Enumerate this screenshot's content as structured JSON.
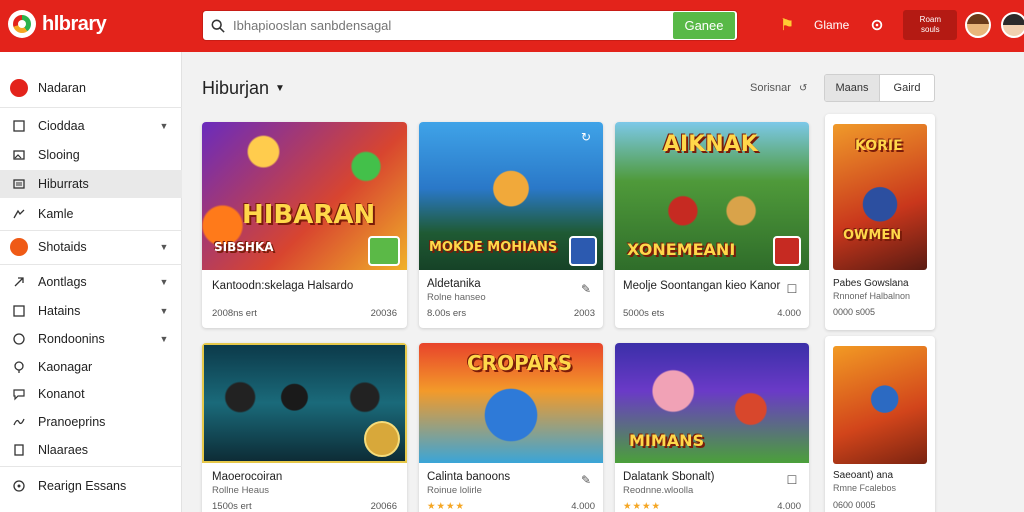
{
  "app": {
    "title": "hlbrary"
  },
  "search": {
    "placeholder": "Ibhapiooslan sanbdensagal",
    "button_label": "Ganee"
  },
  "topbar": {
    "game_label": "Glame",
    "account_line1": "Roam",
    "account_line2": "souls"
  },
  "sidebar": {
    "items": [
      {
        "label": "Nadaran",
        "icon": "home-icon",
        "has_caret": false
      },
      {
        "label": "Cioddaa",
        "icon": "square-icon",
        "has_caret": true
      },
      {
        "label": "Slooing",
        "icon": "image-icon",
        "has_caret": false
      },
      {
        "label": "Hiburrats",
        "icon": "list-icon",
        "has_caret": false,
        "active": true
      },
      {
        "label": "Kamle",
        "icon": "puzzle-icon",
        "has_caret": false
      },
      {
        "label": "Shotaids",
        "icon": "fire-icon",
        "has_caret": true
      },
      {
        "label": "Aontlags",
        "icon": "arrow-icon",
        "has_caret": true
      },
      {
        "label": "Hatains",
        "icon": "square-icon",
        "has_caret": true
      },
      {
        "label": "Rondoonins",
        "icon": "clock-icon",
        "has_caret": true
      },
      {
        "label": "Kaonagar",
        "icon": "pin-icon",
        "has_caret": false
      },
      {
        "label": "Konanot",
        "icon": "chat-icon",
        "has_caret": false
      },
      {
        "label": "Pranoeprins",
        "icon": "wave-icon",
        "has_caret": false
      },
      {
        "label": "Nlaaraes",
        "icon": "doc-icon",
        "has_caret": false
      },
      {
        "label": "Rearign Essans",
        "icon": "circle-icon",
        "has_caret": false
      }
    ]
  },
  "main": {
    "title": "Hiburjan",
    "sort_label": "Sorisnar",
    "segments": [
      "Maans",
      "Gaird"
    ]
  },
  "cards": [
    {
      "title": "Kantoodn:skelaga Halsardo",
      "sub": "",
      "meta_left": "2008ns ert",
      "meta_right": "20036",
      "overlay": "HIBARAN",
      "overlay2": "SIBSHKA"
    },
    {
      "title": "Aldetanika",
      "sub": "Rolne hanseo",
      "meta_left": "8.00s ers",
      "meta_right": "2003",
      "overlay": "MOKDE MOHIANS"
    },
    {
      "title": "Meolje Soontangan kieo Kanor",
      "sub": "",
      "meta_left": "5000s ets",
      "meta_right": "4.000",
      "overlay": "AIKNAK",
      "overlay2": "XONEMEANI"
    },
    {
      "title": "Pabes Gowslana",
      "sub": "Rnnonef Halbalnon",
      "meta_left": "0000 s005",
      "meta_right": "",
      "overlay": "KORIE",
      "overlay2": "OWMEN"
    },
    {
      "title": "Maoerocoiran",
      "sub": "Rollne Heaus",
      "meta_left": "1500s ert",
      "meta_right": "20066",
      "overlay": ""
    },
    {
      "title": "Calinta banoons",
      "sub": "Roinue lolirle",
      "meta_left": "★★★★",
      "meta_right": "4.000",
      "overlay": "CROPARS"
    },
    {
      "title": "Dalatank Sbonalt)",
      "sub": "Reodnne.wloolla",
      "meta_left": "★★★★",
      "meta_right": "4.000",
      "overlay": "MIMANS"
    },
    {
      "title": "Saeoant) ana",
      "sub": "Rmne Fcalebos",
      "meta_left": "0600 0005",
      "meta_right": "",
      "overlay": ""
    }
  ],
  "colors": {
    "brand": "#e3231b",
    "accent_green": "#58b947",
    "star": "#f5a623"
  }
}
